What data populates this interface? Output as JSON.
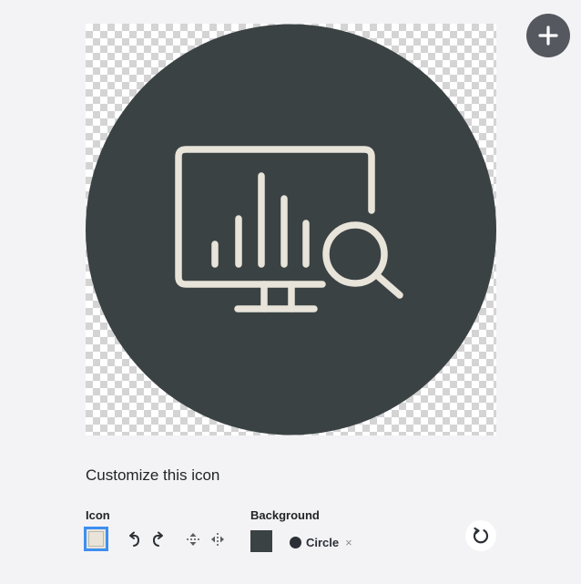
{
  "colors": {
    "background": "#3b4244",
    "icon": "#e8e4da",
    "accent": "#3d8ff0",
    "add_button": "#55585f"
  },
  "preview": {
    "icon_name": "monitor-analytics-search-icon",
    "shape": "circle"
  },
  "header": {
    "add_icon": "plus-icon"
  },
  "customize": {
    "title": "Customize this icon",
    "icon_section": {
      "label": "Icon",
      "tools": [
        "rotate-left-icon",
        "rotate-right-icon",
        "flip-vertical-icon",
        "flip-horizontal-icon"
      ]
    },
    "background_section": {
      "label": "Background",
      "shape_label": "Circle",
      "remove_symbol": "×"
    },
    "reset_icon": "reset-icon"
  }
}
